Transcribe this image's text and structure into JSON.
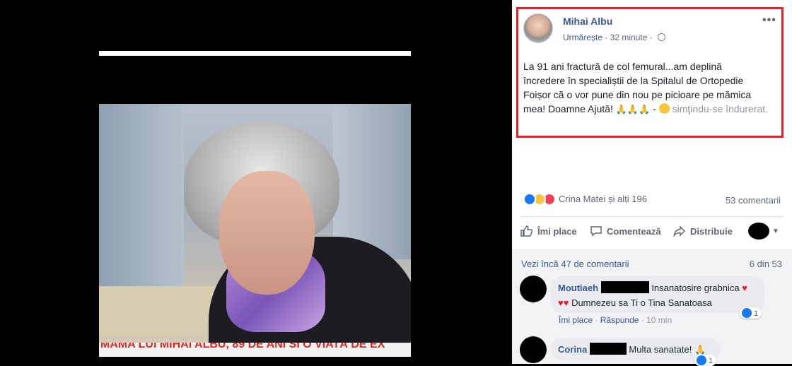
{
  "photo": {
    "caption": "MAMA LUI MIHAI ALBU, 89 DE ANI SI O VIATĂ DE EX"
  },
  "post": {
    "author": "Mihai Albu",
    "follow_label": "Urmărește",
    "time": "32 minute",
    "more_label": "•••",
    "text_line1": "La 91 ani fractură de col femural...am deplină",
    "text_line2": "încredere în specialiștii de la Spitalul de Ortopedie",
    "text_line3": "Foișor că o vor pune din nou pe picioare pe mămica",
    "text_line4": "mea! Doamne Ajută!",
    "pray_emojis": "🙏🙏🙏",
    "separator": "-",
    "feeling": "simţindu-se îndurerat."
  },
  "reactions": {
    "names": "Crina Matei și alți 196",
    "comments_count": "53 comentarii"
  },
  "actions": {
    "like": "Îmi place",
    "comment": "Comentează",
    "share": "Distribuie"
  },
  "comments_section": {
    "view_more": "Vezi încă 47 de comentarii",
    "page_count": "6 din 53",
    "items": [
      {
        "name": "Moutiaeh",
        "text_line1": "Insanatosire grabnica",
        "text_line2": "Dumnezeu sa Ti o Tina Sanatoasa",
        "reaction_count": "1",
        "like_label": "Îmi place",
        "reply_label": "Răspunde",
        "time": "10 min"
      },
      {
        "name": "Corina",
        "text": "Multa sanatate!",
        "reaction_count": "1"
      }
    ]
  },
  "colors": {
    "brand_link": "#385898",
    "highlight_border": "#e0232a",
    "like_blue": "#1877f2",
    "heart_red": "#e81c2e"
  }
}
